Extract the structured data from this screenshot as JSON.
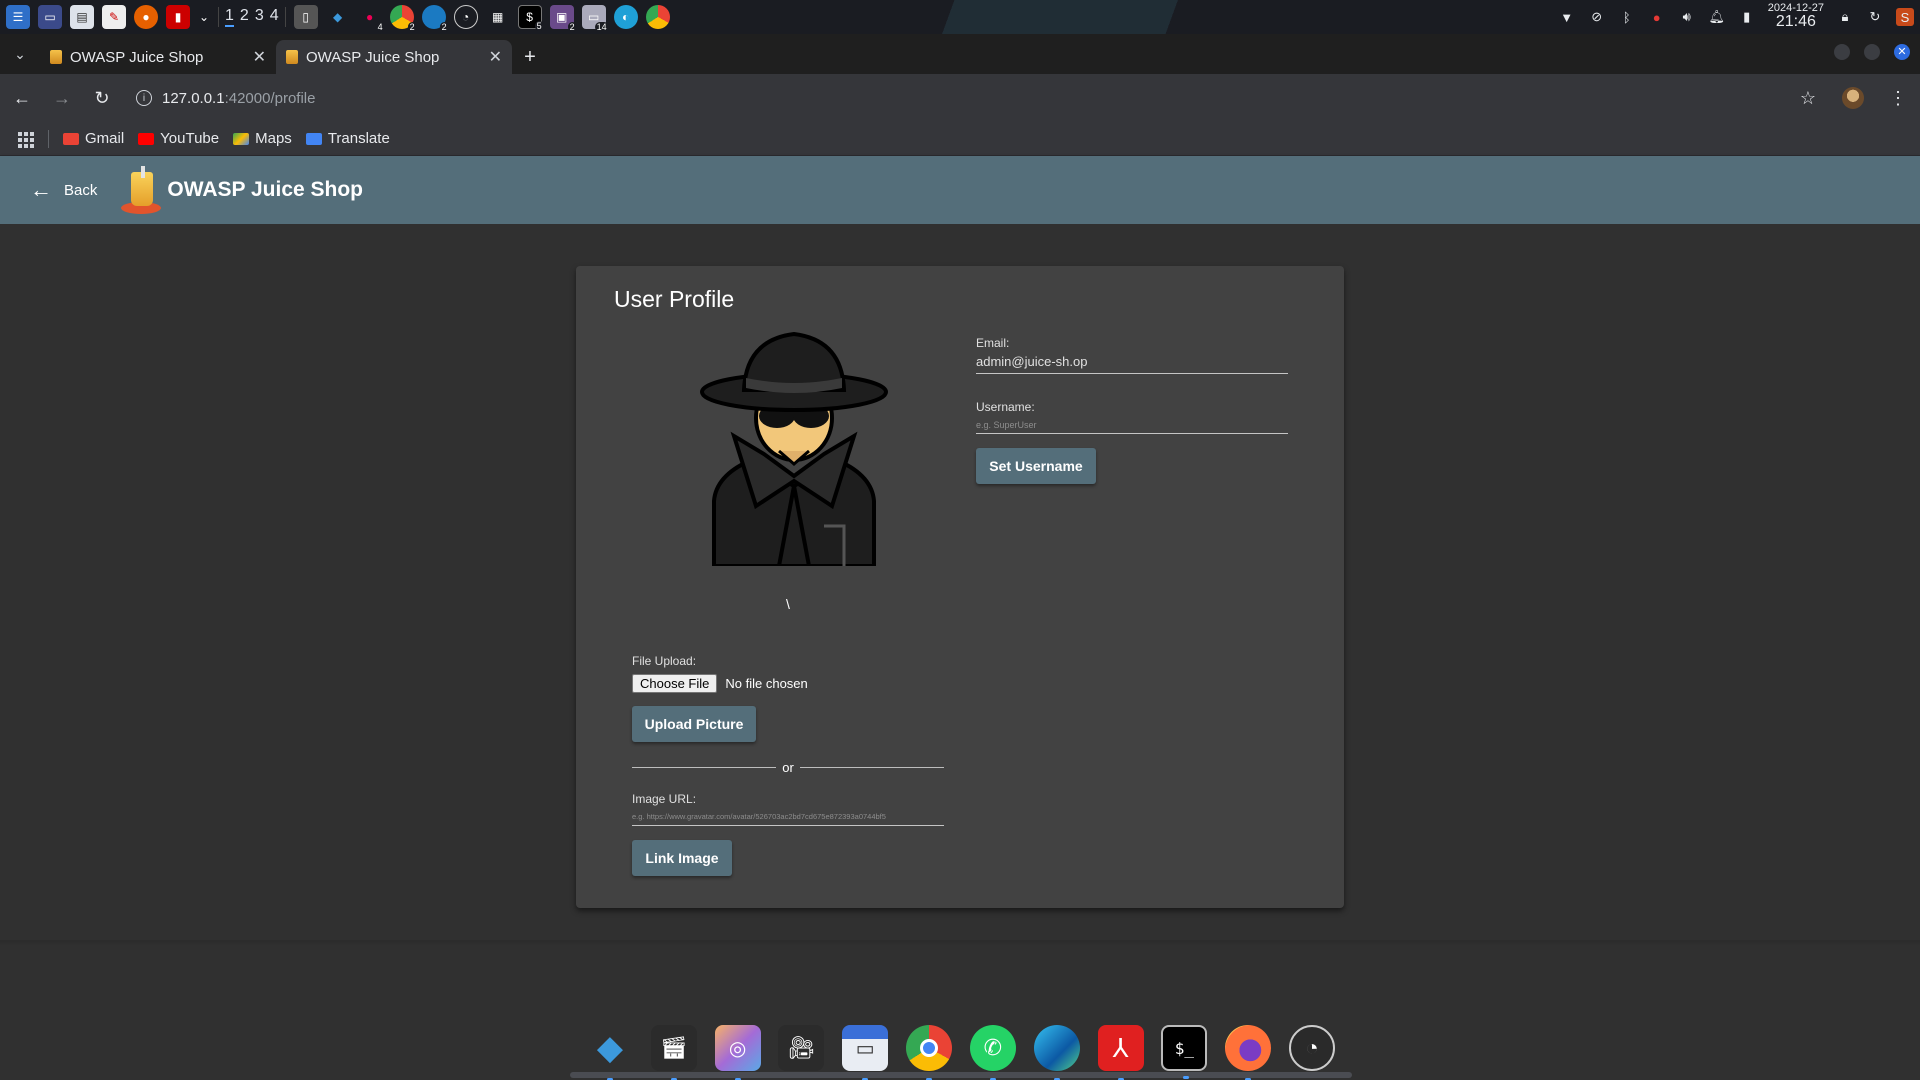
{
  "os_panel": {
    "workspaces": [
      "1",
      "2",
      "3",
      "4"
    ],
    "badges": {
      "chrome": "4",
      "obs": "2",
      "edge": "2",
      "terminal": "5",
      "files": "2",
      "folder": "14"
    },
    "clock": {
      "date": "2024-12-27",
      "time": "21:46"
    }
  },
  "browser": {
    "tabs": [
      {
        "title": "OWASP Juice Shop",
        "active": false
      },
      {
        "title": "OWASP Juice Shop",
        "active": true
      }
    ],
    "url_host": "127.0.0.1",
    "url_path": ":42000/profile",
    "bookmarks": [
      {
        "label": "Gmail",
        "icon": "gmail-icon",
        "color": "#ea4335"
      },
      {
        "label": "YouTube",
        "icon": "youtube-icon",
        "color": "#ff0000"
      },
      {
        "label": "Maps",
        "icon": "maps-icon",
        "color": "#34a853"
      },
      {
        "label": "Translate",
        "icon": "translate-icon",
        "color": "#4285f4"
      }
    ]
  },
  "app": {
    "back_label": "Back",
    "brand_name": "OWASP Juice Shop",
    "accent": "#546e7a"
  },
  "profile": {
    "title": "User Profile",
    "avatar_caption": "\\",
    "email_label": "Email:",
    "email_value": "admin@juice-sh.op",
    "username_label": "Username:",
    "username_placeholder": "e.g. SuperUser",
    "set_username_button": "Set Username",
    "file_upload_label": "File Upload:",
    "choose_file_button": "Choose File",
    "no_file_text": "No file chosen",
    "upload_button": "Upload Picture",
    "or_text": "or",
    "image_url_label": "Image URL:",
    "image_url_placeholder": "e.g. https://www.gravatar.com/avatar/526703ac2bd7cd675e872393a0744bf5",
    "link_button": "Link Image"
  },
  "dock": [
    "vscode-icon",
    "screen-recorder-icon",
    "image-viewer-icon",
    "video-recorder-icon",
    "file-manager-icon",
    "chrome-icon",
    "whatsapp-icon",
    "edge-icon",
    "pdf-reader-icon",
    "terminal-icon",
    "firefox-icon",
    "obs-icon"
  ]
}
